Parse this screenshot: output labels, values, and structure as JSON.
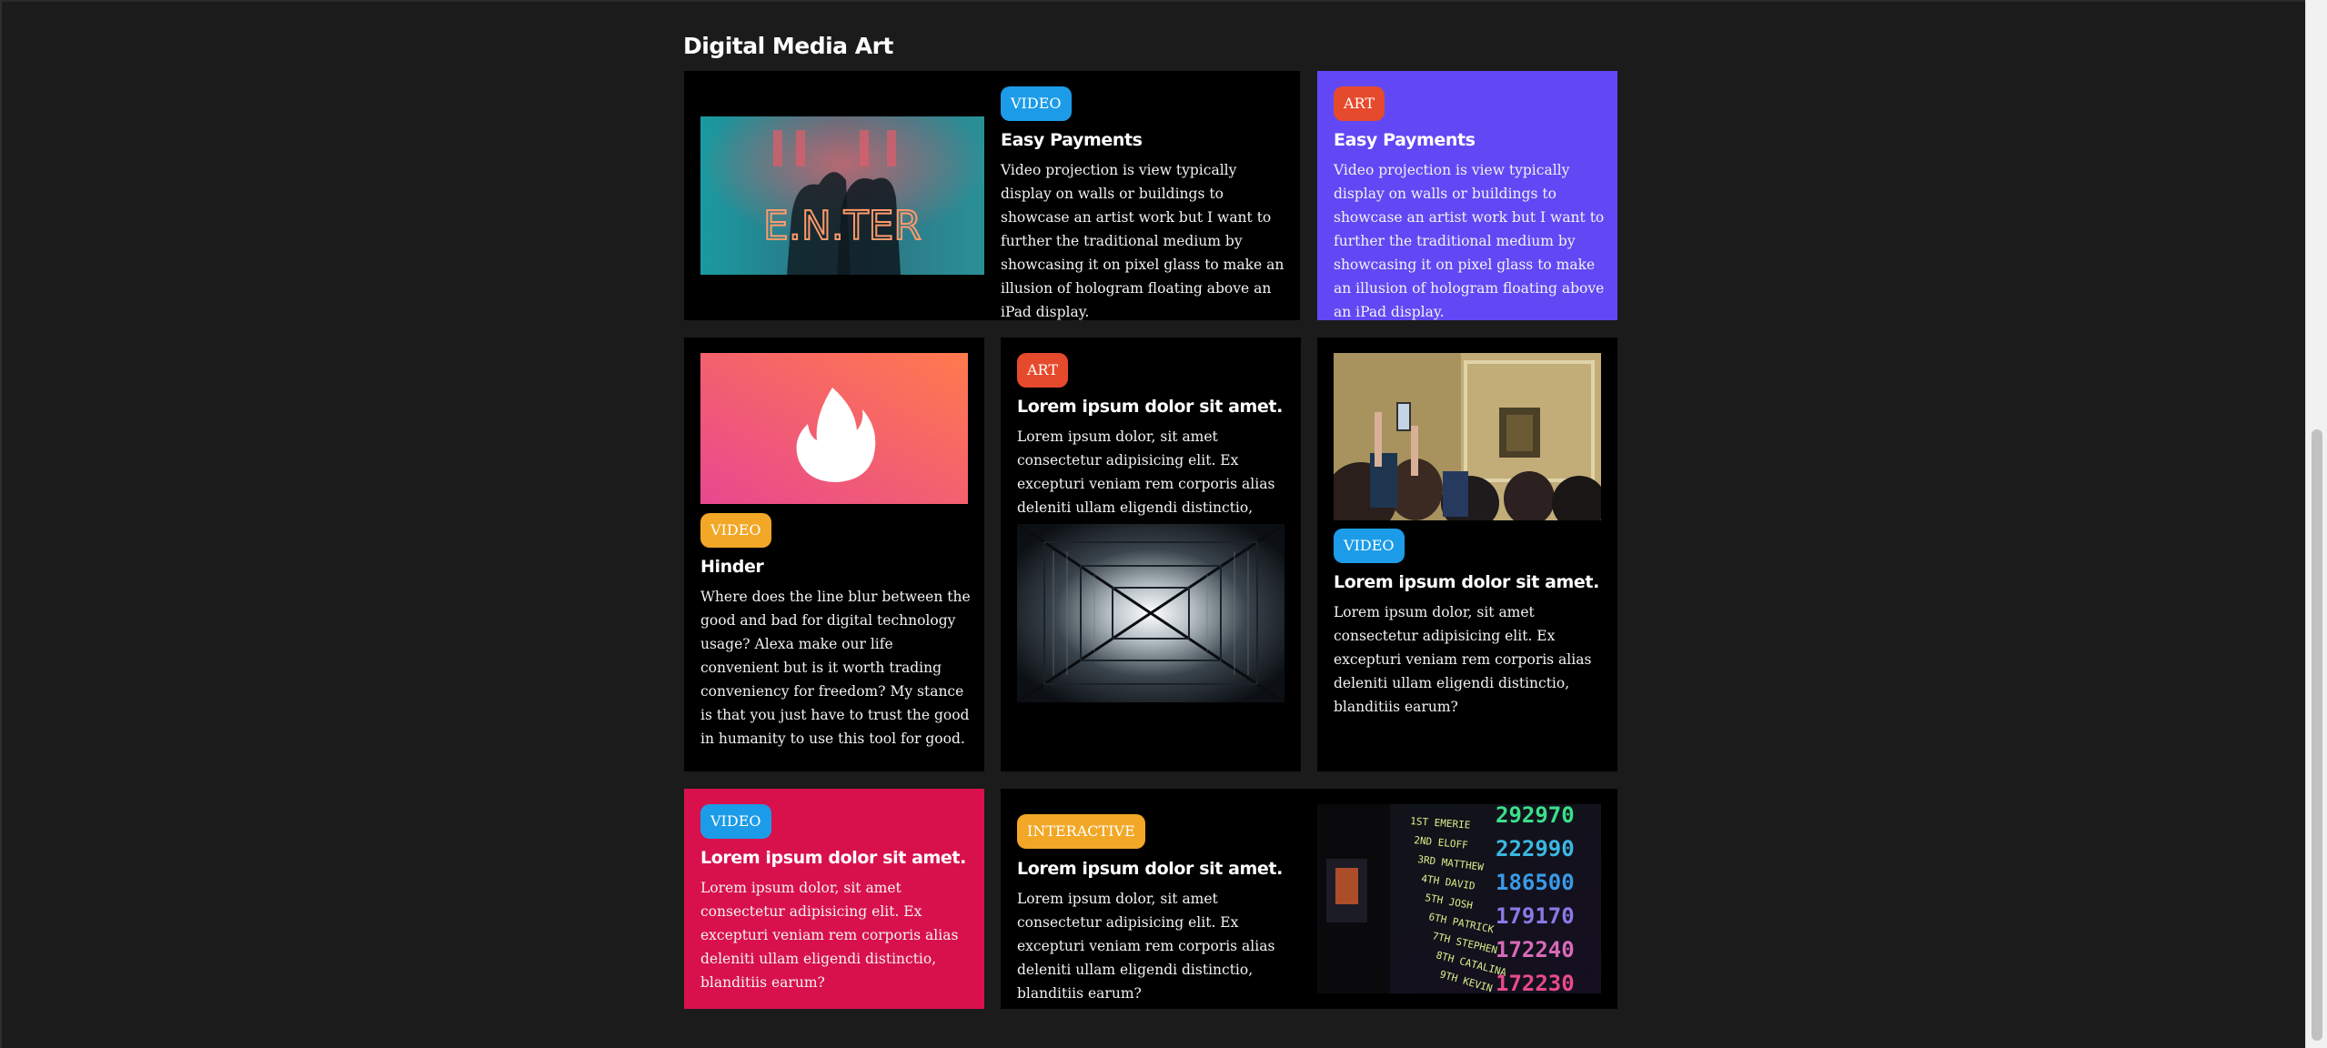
{
  "section": {
    "title": "Digital Media Art"
  },
  "colors": {
    "video": "#1c9ce8",
    "art": "#e64a2c",
    "interactive": "#f2a726",
    "purple": "#6148f4",
    "pink": "#d8114c"
  },
  "cards": {
    "c1": {
      "tag": "VIDEO",
      "title": "Easy Payments",
      "text": "Video projection is view typically display on walls or buildings to showcase an artist work but I want to further the traditional medium by showcasing it on pixel glass to make an illusion of hologram floating above an iPad display.",
      "image": "neon-enter-photo",
      "sign": "E.N.TER"
    },
    "c2": {
      "tag": "ART",
      "title": "Easy Payments",
      "text": "Video projection is view typically display on walls or buildings to showcase an artist work but I want to further the traditional medium by showcasing it on pixel glass to make an illusion of hologram floating above an iPad display."
    },
    "c3": {
      "tag": "VIDEO",
      "title": "Hinder",
      "text": "Where does the line blur between the good and bad for digital technology usage? Alexa make our life convenient but is it worth trading conveniency for freedom? My stance is that you just have to trust the good in humanity to use this tool for good.",
      "image": "flame-logo"
    },
    "c4": {
      "tag": "ART",
      "title": "Lorem ipsum dolor sit amet.",
      "text": "Lorem ipsum dolor, sit amet consectetur adipisicing elit. Ex excepturi veniam rem corporis alias deleniti ullam eligendi distinctio, blanditiis earum?",
      "image": "architecture-photo"
    },
    "c5": {
      "tag": "VIDEO",
      "title": "Lorem ipsum dolor sit amet.",
      "text": "Lorem ipsum dolor, sit amet consectetur adipisicing elit. Ex excepturi veniam rem corporis alias deleniti ullam eligendi distinctio, blanditiis earum?",
      "image": "museum-photo"
    },
    "c6": {
      "tag": "VIDEO",
      "title": "Lorem ipsum dolor sit amet.",
      "text": "Lorem ipsum dolor, sit amet consectetur adipisicing elit. Ex excepturi veniam rem corporis alias deleniti ullam eligendi distinctio, blanditiis earum?"
    },
    "c7": {
      "tag": "INTERACTIVE",
      "title": "Lorem ipsum dolor sit amet.",
      "text": "Lorem ipsum dolor, sit amet consectetur adipisicing elit. Ex excepturi veniam rem corporis alias deleniti ullam eligendi distinctio, blanditiis earum?",
      "image": "scoreboard-photo",
      "scoreboard": {
        "names": [
          "1ST EMERIE",
          "2ND ELOFF",
          "3RD MATTHEW",
          "4TH DAVID",
          "5TH JOSH",
          "6TH PATRICK",
          "7TH STEPHEN",
          "8TH CATALINA",
          "9TH KEVIN"
        ],
        "scores": [
          "292970",
          "222990",
          "186500",
          "179170",
          "172240",
          "172230"
        ]
      }
    }
  }
}
